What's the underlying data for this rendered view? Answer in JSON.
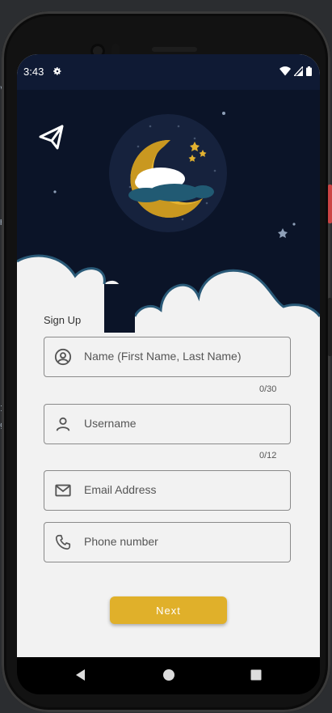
{
  "status_bar": {
    "time": "3:43",
    "icons": [
      "gear-icon",
      "wifi-icon",
      "signal-icon",
      "battery-icon"
    ]
  },
  "header": {
    "back_icon": "send-arrow-icon",
    "illustration": "moon-clouds-night-illustration"
  },
  "form": {
    "title": "Sign Up",
    "fields": [
      {
        "label": "Name (First Name, Last Name)",
        "icon": "account-circle-icon",
        "counter": "0/30"
      },
      {
        "label": "Username",
        "icon": "person-icon",
        "counter": "0/12"
      },
      {
        "label": "Email Address",
        "icon": "mail-icon",
        "counter": ""
      },
      {
        "label": "Phone number",
        "icon": "phone-icon",
        "counter": ""
      }
    ],
    "next_label": "Next"
  },
  "colors": {
    "night_sky": "#0b1428",
    "accent": "#e0b02a",
    "background": "#f2f2f2",
    "cloud_outline": "#2a5a78"
  }
}
